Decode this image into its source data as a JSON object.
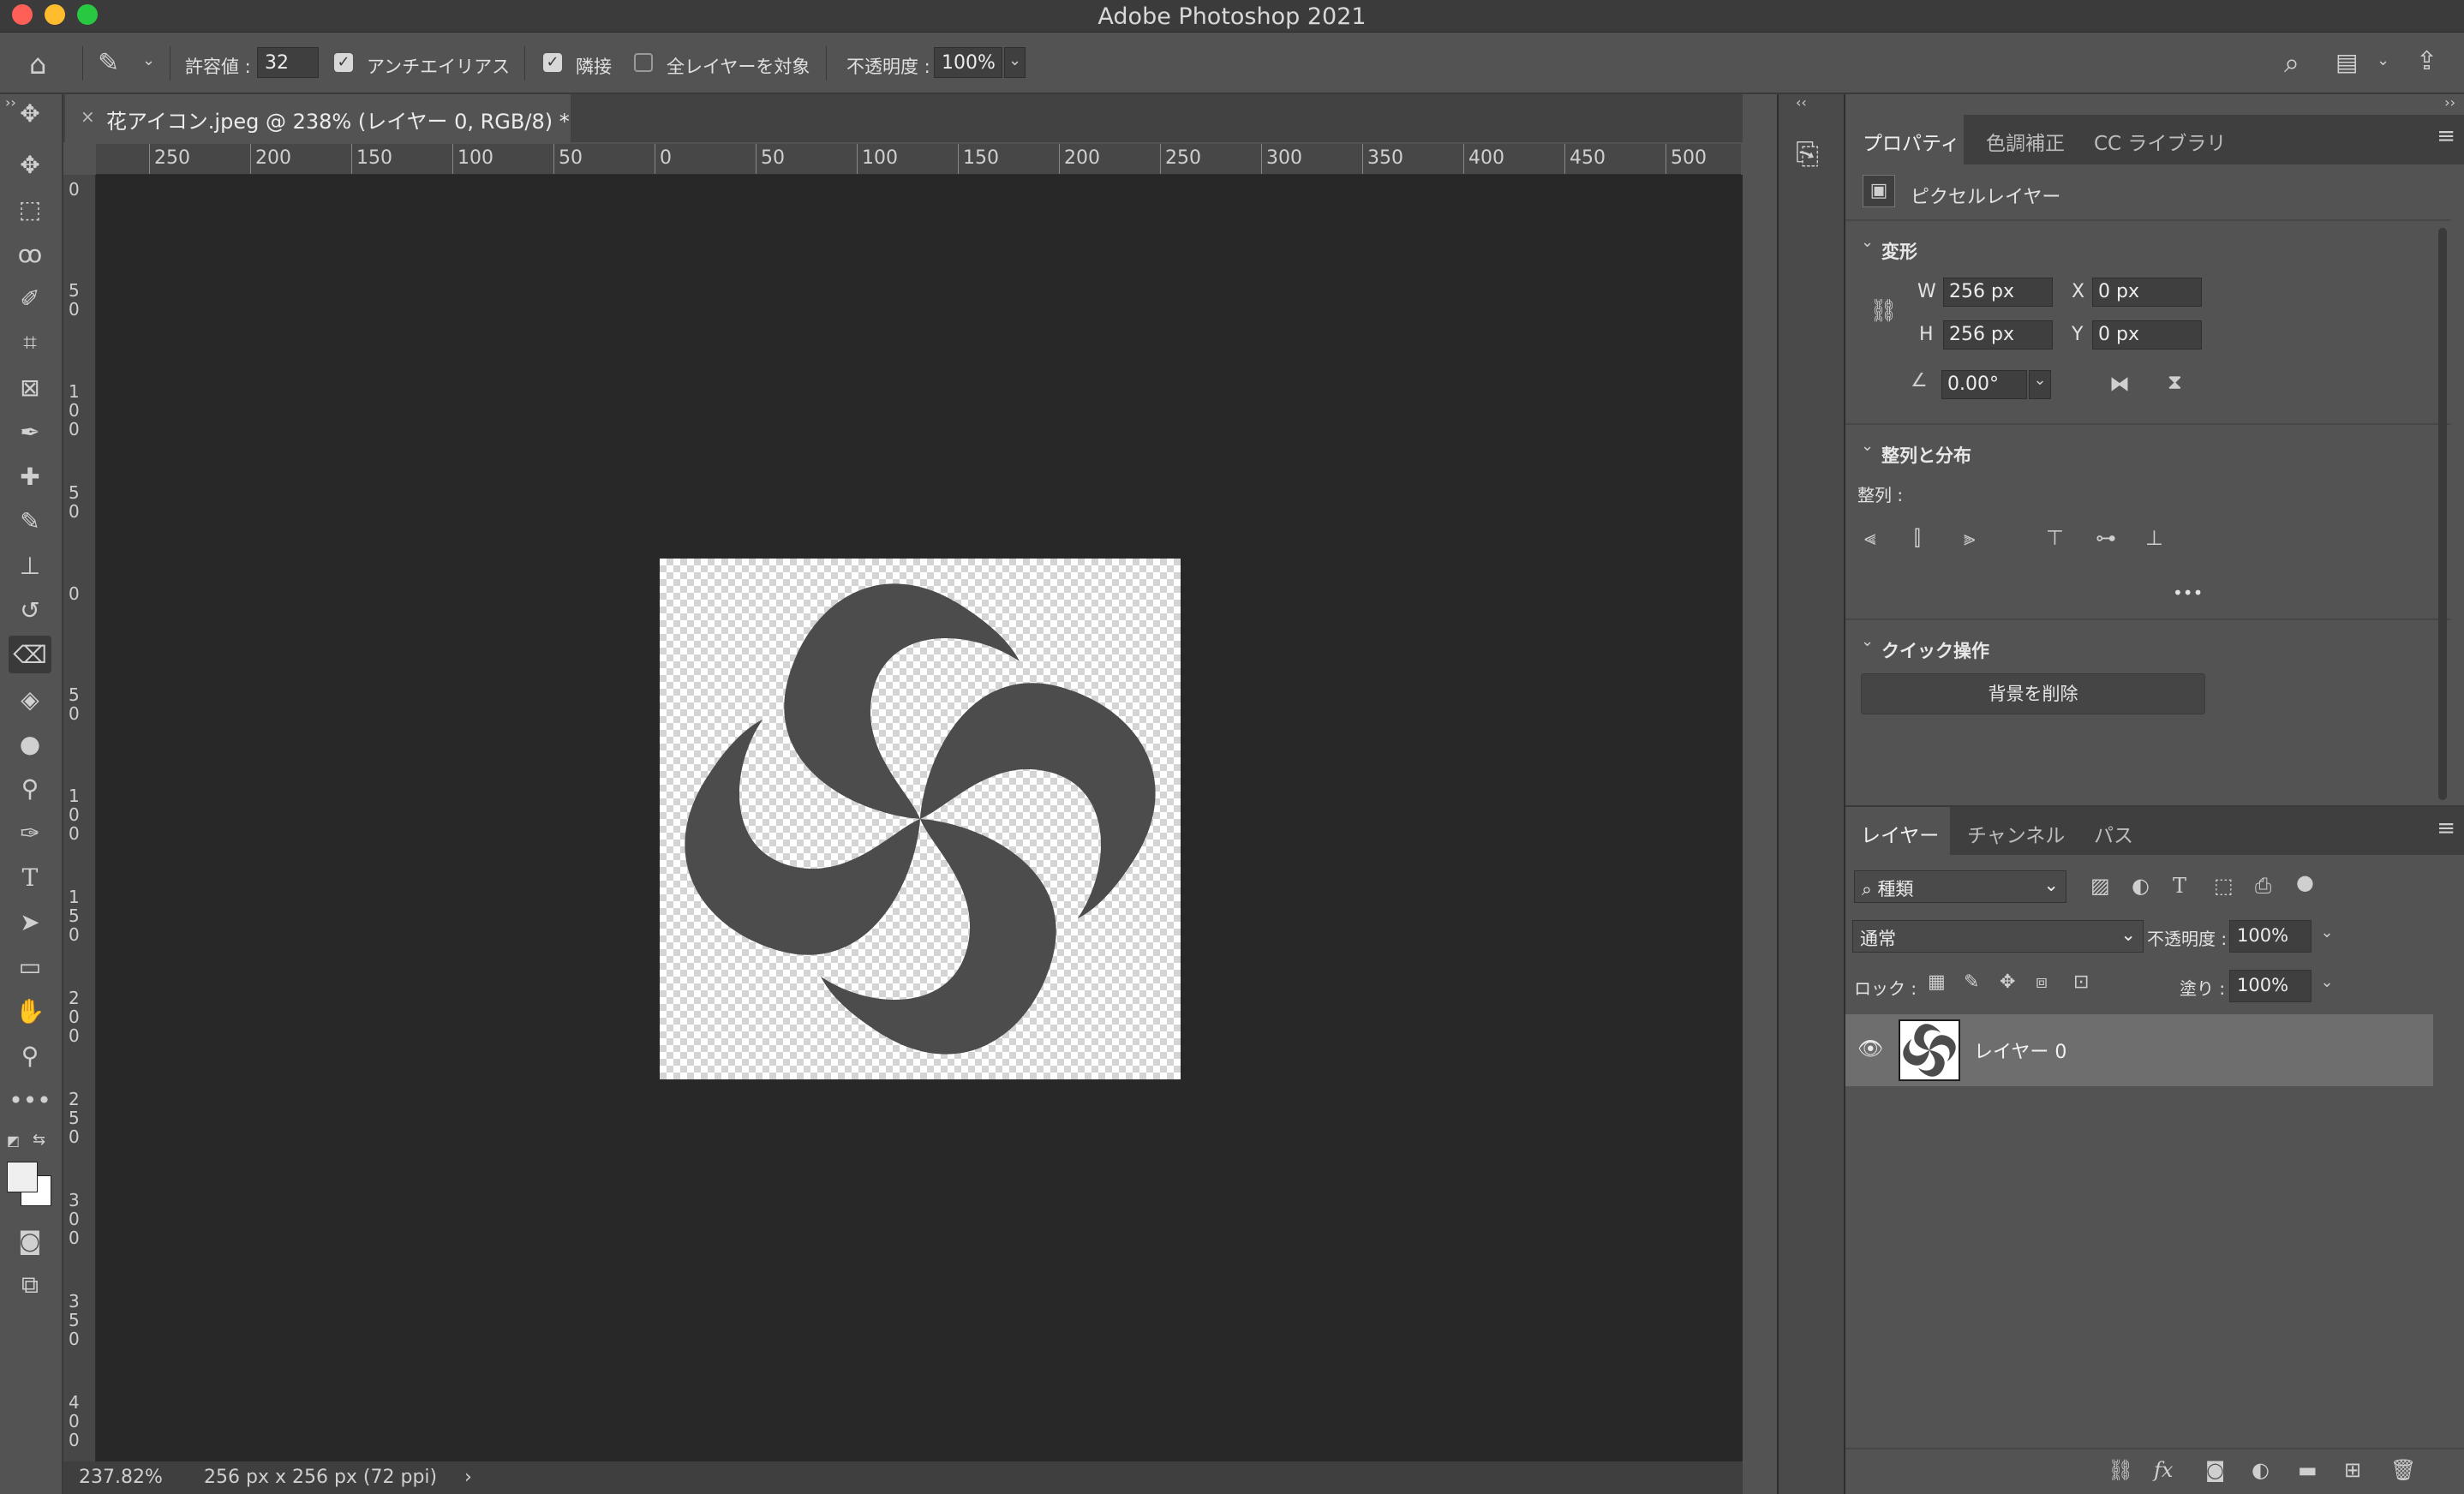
{
  "window": {
    "title": "Adobe Photoshop 2021"
  },
  "options_bar": {
    "tolerance_label": "許容値 :",
    "tolerance_value": "32",
    "antialias_label": "アンチエイリアス",
    "antialias_checked": true,
    "contiguous_label": "隣接",
    "contiguous_checked": true,
    "all_layers_label": "全レイヤーを対象",
    "all_layers_checked": false,
    "opacity_label": "不透明度 :",
    "opacity_value": "100%"
  },
  "document": {
    "tab_label": "花アイコン.jpeg @ 238% (レイヤー 0, RGB/8) *",
    "close_glyph": "×"
  },
  "rulers": {
    "horizontal": [
      "250",
      "200",
      "150",
      "100",
      "50",
      "0",
      "50",
      "100",
      "150",
      "200",
      "250",
      "300",
      "350",
      "400",
      "450",
      "500"
    ],
    "vertical": [
      "0",
      "50",
      "100",
      "50",
      "0",
      "50",
      "100",
      "150",
      "200",
      "250",
      "300",
      "350",
      "400"
    ]
  },
  "status_bar": {
    "zoom": "237.82%",
    "doc_info": "256 px x 256 px (72 ppi)",
    "arrow": "›"
  },
  "properties_panel": {
    "tabs": [
      "プロパティ",
      "色調補正",
      "CC ライブラリ"
    ],
    "active_tab": 0,
    "layer_kind": "ピクセルレイヤー",
    "transform": {
      "heading": "変形",
      "w_label": "W",
      "w_value": "256 px",
      "h_label": "H",
      "h_value": "256 px",
      "x_label": "X",
      "x_value": "0 px",
      "y_label": "Y",
      "y_value": "0 px",
      "angle_value": "0.00°"
    },
    "align": {
      "heading": "整列と分布",
      "sub_label": "整列 :",
      "more": "•••"
    },
    "quick_actions": {
      "heading": "クイック操作",
      "remove_bg_button": "背景を削除"
    }
  },
  "layers_panel": {
    "tabs": [
      "レイヤー",
      "チャンネル",
      "パス"
    ],
    "active_tab": 0,
    "filter_kind": "種類",
    "blend_mode": "通常",
    "opacity_label": "不透明度 :",
    "opacity_value": "100%",
    "lock_label": "ロック :",
    "fill_label": "塗り :",
    "fill_value": "100%",
    "layers": [
      {
        "name": "レイヤー 0",
        "visible": true,
        "selected": true
      }
    ]
  },
  "colors": {
    "ui_bg": "#535353",
    "canvas_bg": "#282828",
    "shape_fill": "#4c4c4c"
  }
}
